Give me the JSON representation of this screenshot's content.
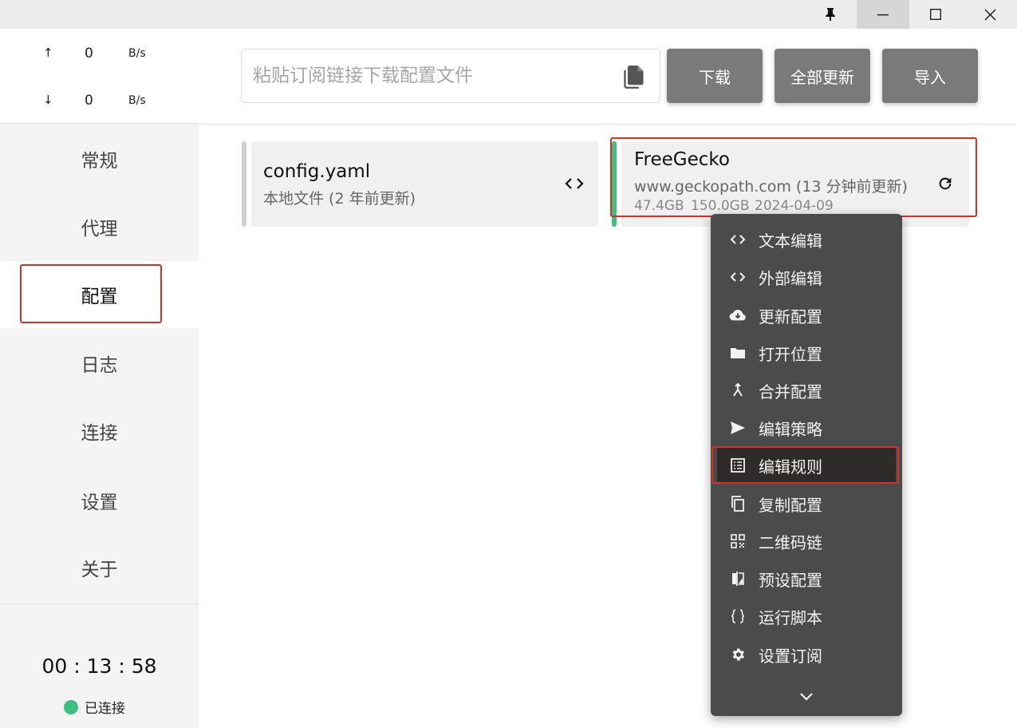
{
  "titlebar": {
    "icons": [
      "pin-icon",
      "minimize-icon",
      "maximize-icon",
      "close-icon"
    ]
  },
  "traffic": {
    "up": {
      "arrow": "↑",
      "value": "0",
      "unit": "B/s"
    },
    "down": {
      "arrow": "↓",
      "value": "0",
      "unit": "B/s"
    }
  },
  "sidebar": {
    "items": [
      {
        "label": "常规"
      },
      {
        "label": "代理"
      },
      {
        "label": "配置"
      },
      {
        "label": "日志"
      },
      {
        "label": "连接"
      },
      {
        "label": "设置"
      },
      {
        "label": "关于"
      }
    ],
    "active_index": 2,
    "timer": "00 : 13 : 58",
    "status": "已连接",
    "status_color": "#3fbf7f"
  },
  "header": {
    "url_placeholder": "粘贴订阅链接下载配置文件",
    "url_value": "",
    "download_label": "下载",
    "update_all_label": "全部更新",
    "import_label": "导入",
    "button_color": "#7a7a7a"
  },
  "profiles": [
    {
      "title": "config.yaml",
      "subtitle": "本地文件 (2 年前更新)",
      "action_icon": "code-icon"
    },
    {
      "title": "FreeGecko",
      "subtitle": "www.geckopath.com (13 分钟前更新)",
      "used": "47.4GB",
      "total": "150.0GB",
      "expire": "2024-04-09",
      "usage_fraction": 0.316,
      "action_icon": "refresh-icon",
      "active_color": "#3fbf7f",
      "usage_color": "#e53935"
    }
  ],
  "context_menu": {
    "items": [
      {
        "label": "文本编辑",
        "icon": "code-icon"
      },
      {
        "label": "外部编辑",
        "icon": "code-icon"
      },
      {
        "label": "更新配置",
        "icon": "cloud-download-icon"
      },
      {
        "label": "打开位置",
        "icon": "folder-icon"
      },
      {
        "label": "合并配置",
        "icon": "merge-icon"
      },
      {
        "label": "编辑策略",
        "icon": "send-icon"
      },
      {
        "label": "编辑规则",
        "icon": "list-icon"
      },
      {
        "label": "复制配置",
        "icon": "copy-icon"
      },
      {
        "label": "二维码链",
        "icon": "qrcode-icon"
      },
      {
        "label": "预设配置",
        "icon": "compare-icon"
      },
      {
        "label": "运行脚本",
        "icon": "braces-icon"
      },
      {
        "label": "设置订阅",
        "icon": "gear-icon"
      }
    ],
    "selected_index": 6,
    "more_icon": "chevron-down-icon",
    "bg_color": "#4b4b4b"
  },
  "highlight_color": "#d93025"
}
